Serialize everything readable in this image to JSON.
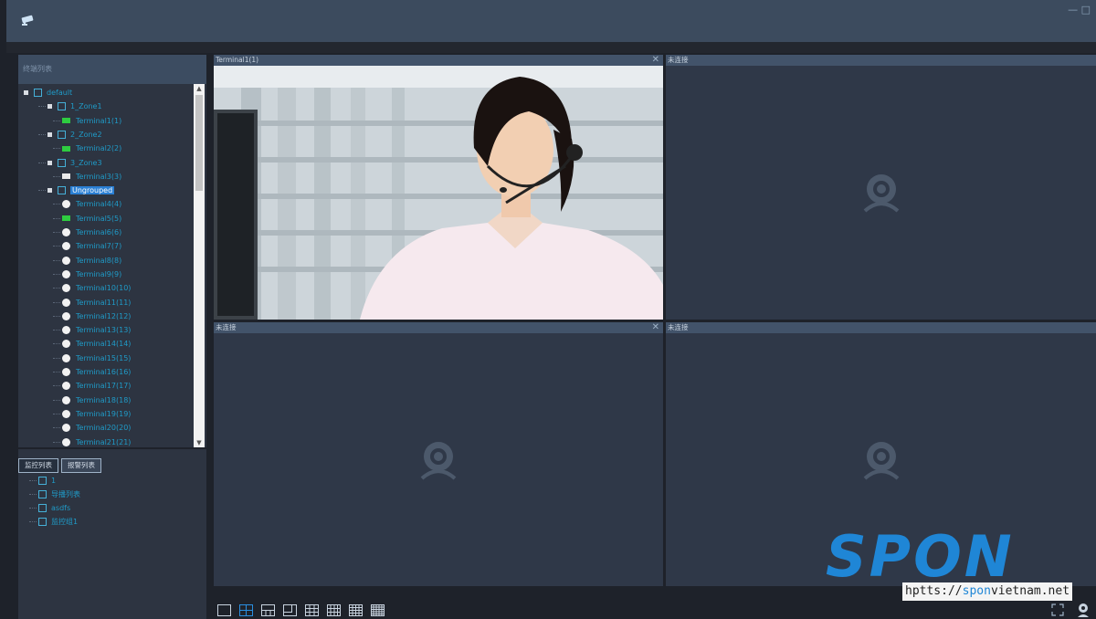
{
  "window": {
    "logo_icon": "camera-icon",
    "controls_text": "— □"
  },
  "left_panel": {
    "header": "终端列表",
    "tree": [
      {
        "label": "default",
        "level": 0,
        "icon": "folder"
      },
      {
        "label": "1_Zone1",
        "level": 1,
        "icon": "folder"
      },
      {
        "label": "Terminal1(1)",
        "level": 2,
        "icon": "cam-green"
      },
      {
        "label": "2_Zone2",
        "level": 1,
        "icon": "folder"
      },
      {
        "label": "Terminal2(2)",
        "level": 2,
        "icon": "cam-green"
      },
      {
        "label": "3_Zone3",
        "level": 1,
        "icon": "folder"
      },
      {
        "label": "Terminal3(3)",
        "level": 2,
        "icon": "cam-white"
      },
      {
        "label": "Ungrouped",
        "level": 1,
        "icon": "folder",
        "selected": true
      },
      {
        "label": "Terminal4(4)",
        "level": 2,
        "icon": "dot"
      },
      {
        "label": "Terminal5(5)",
        "level": 2,
        "icon": "cam-green"
      },
      {
        "label": "Terminal6(6)",
        "level": 2,
        "icon": "dot"
      },
      {
        "label": "Terminal7(7)",
        "level": 2,
        "icon": "dot"
      },
      {
        "label": "Terminal8(8)",
        "level": 2,
        "icon": "dot"
      },
      {
        "label": "Terminal9(9)",
        "level": 2,
        "icon": "dot"
      },
      {
        "label": "Terminal10(10)",
        "level": 2,
        "icon": "dot"
      },
      {
        "label": "Terminal11(11)",
        "level": 2,
        "icon": "dot"
      },
      {
        "label": "Terminal12(12)",
        "level": 2,
        "icon": "dot"
      },
      {
        "label": "Terminal13(13)",
        "level": 2,
        "icon": "dot"
      },
      {
        "label": "Terminal14(14)",
        "level": 2,
        "icon": "dot"
      },
      {
        "label": "Terminal15(15)",
        "level": 2,
        "icon": "dot"
      },
      {
        "label": "Terminal16(16)",
        "level": 2,
        "icon": "dot"
      },
      {
        "label": "Terminal17(17)",
        "level": 2,
        "icon": "dot"
      },
      {
        "label": "Terminal18(18)",
        "level": 2,
        "icon": "dot"
      },
      {
        "label": "Terminal19(19)",
        "level": 2,
        "icon": "dot"
      },
      {
        "label": "Terminal20(20)",
        "level": 2,
        "icon": "dot"
      },
      {
        "label": "Terminal21(21)",
        "level": 2,
        "icon": "dot"
      }
    ]
  },
  "bottom_panel": {
    "tabs": [
      "监控列表",
      "报警列表"
    ],
    "items": [
      "1",
      "导播列表",
      "asdfs",
      "监控组1"
    ]
  },
  "panes": [
    {
      "title": "Terminal1(1)",
      "has_video": true,
      "close": "✕"
    },
    {
      "title": "未连接",
      "has_video": false,
      "close": ""
    },
    {
      "title": "未连接",
      "has_video": false,
      "close": "✕"
    },
    {
      "title": "未连接",
      "has_video": false,
      "close": ""
    }
  ],
  "watermark": {
    "logo": "SPON",
    "url_prefix": "hptts://",
    "url_highlight": "spon",
    "url_suffix": "vietnam.net"
  },
  "colors": {
    "accent": "#1f86d6",
    "tree_text": "#1f9bc8",
    "online": "#2ecc40"
  }
}
